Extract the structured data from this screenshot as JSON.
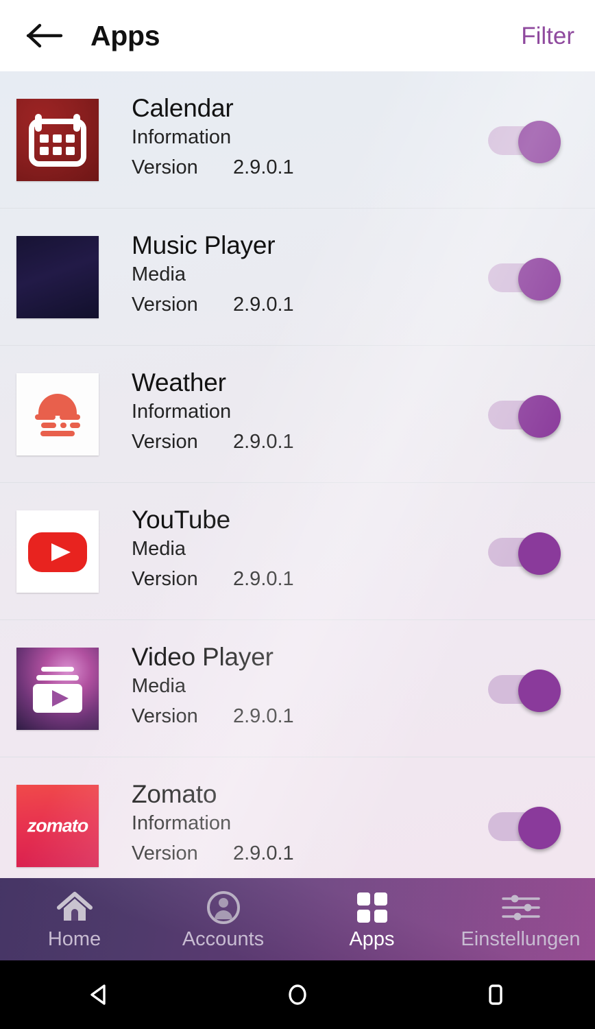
{
  "header": {
    "back_icon": "arrow-left-icon",
    "title": "Apps",
    "filter_label": "Filter",
    "filter_color": "#8f4a9e",
    "background": "#ffffff"
  },
  "list": {
    "version_label": "Version",
    "rows": [
      {
        "name": "Calendar",
        "category": "Information",
        "version_label": "Version",
        "version": "2.9.0.1",
        "icon": "calendar-icon",
        "icon_bg": "#8b1f1f",
        "toggle_on": true
      },
      {
        "name": "Music Player",
        "category": "Media",
        "version_label": "Version",
        "version": "2.9.0.1",
        "icon": "audio-waveform-icon",
        "icon_bg": "#1b1540",
        "toggle_on": true
      },
      {
        "name": "Weather",
        "category": "Information",
        "version_label": "Version",
        "version": "2.9.0.1",
        "icon": "sunset-cloud-icon",
        "icon_bg": "#fdfdfd",
        "toggle_on": true
      },
      {
        "name": "YouTube",
        "category": "Media",
        "version_label": "Version",
        "version": "2.9.0.1",
        "icon": "youtube-play-icon",
        "icon_bg": "#ffffff",
        "toggle_on": true
      },
      {
        "name": "Video Player",
        "category": "Media",
        "version_label": "Version",
        "version": "2.9.0.1",
        "icon": "video-cards-play-icon",
        "icon_bg": "#8b3f84",
        "toggle_on": true
      },
      {
        "name": "Zomato",
        "category": "Information",
        "version_label": "Version",
        "version": "2.9.0.1",
        "icon": "zomato-wordmark-icon",
        "icon_bg": "#e22b4d",
        "icon_text": "zomato",
        "toggle_on": true
      }
    ]
  },
  "tabbar": {
    "accent_on": "#8a3a9b",
    "items": [
      {
        "label": "Home",
        "icon": "home-icon",
        "active": false
      },
      {
        "label": "Accounts",
        "icon": "account-circle-icon",
        "active": false
      },
      {
        "label": "Apps",
        "icon": "grid-apps-icon",
        "active": true
      },
      {
        "label": "Einstellungen",
        "icon": "sliders-settings-icon",
        "active": false
      }
    ]
  },
  "system_nav": {
    "back": "triangle-back-icon",
    "home": "circle-home-icon",
    "recents": "square-recents-icon"
  }
}
